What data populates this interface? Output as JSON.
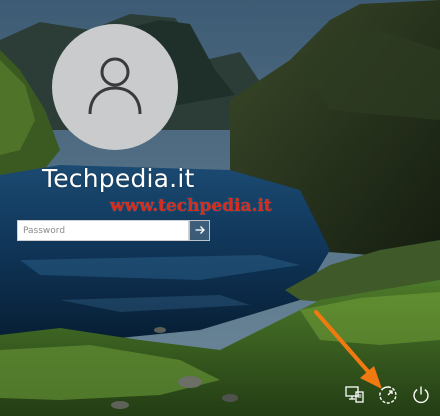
{
  "user": {
    "name": "Techpedia.it",
    "avatar_icon": "user-silhouette-icon"
  },
  "watermark": {
    "text": "www.techpedia.it",
    "color": "#d92a1a"
  },
  "password_field": {
    "placeholder": "Password",
    "value": ""
  },
  "submit_button": {
    "icon": "arrow-right-icon"
  },
  "annotation_arrow": {
    "color": "#f07a0f",
    "points_to": "ease-of-access-button"
  },
  "system_tray": {
    "buttons": [
      {
        "name": "network-button",
        "icon": "network-icon"
      },
      {
        "name": "ease-of-access-button",
        "icon": "ease-of-access-icon"
      },
      {
        "name": "power-button",
        "icon": "power-icon"
      }
    ]
  }
}
